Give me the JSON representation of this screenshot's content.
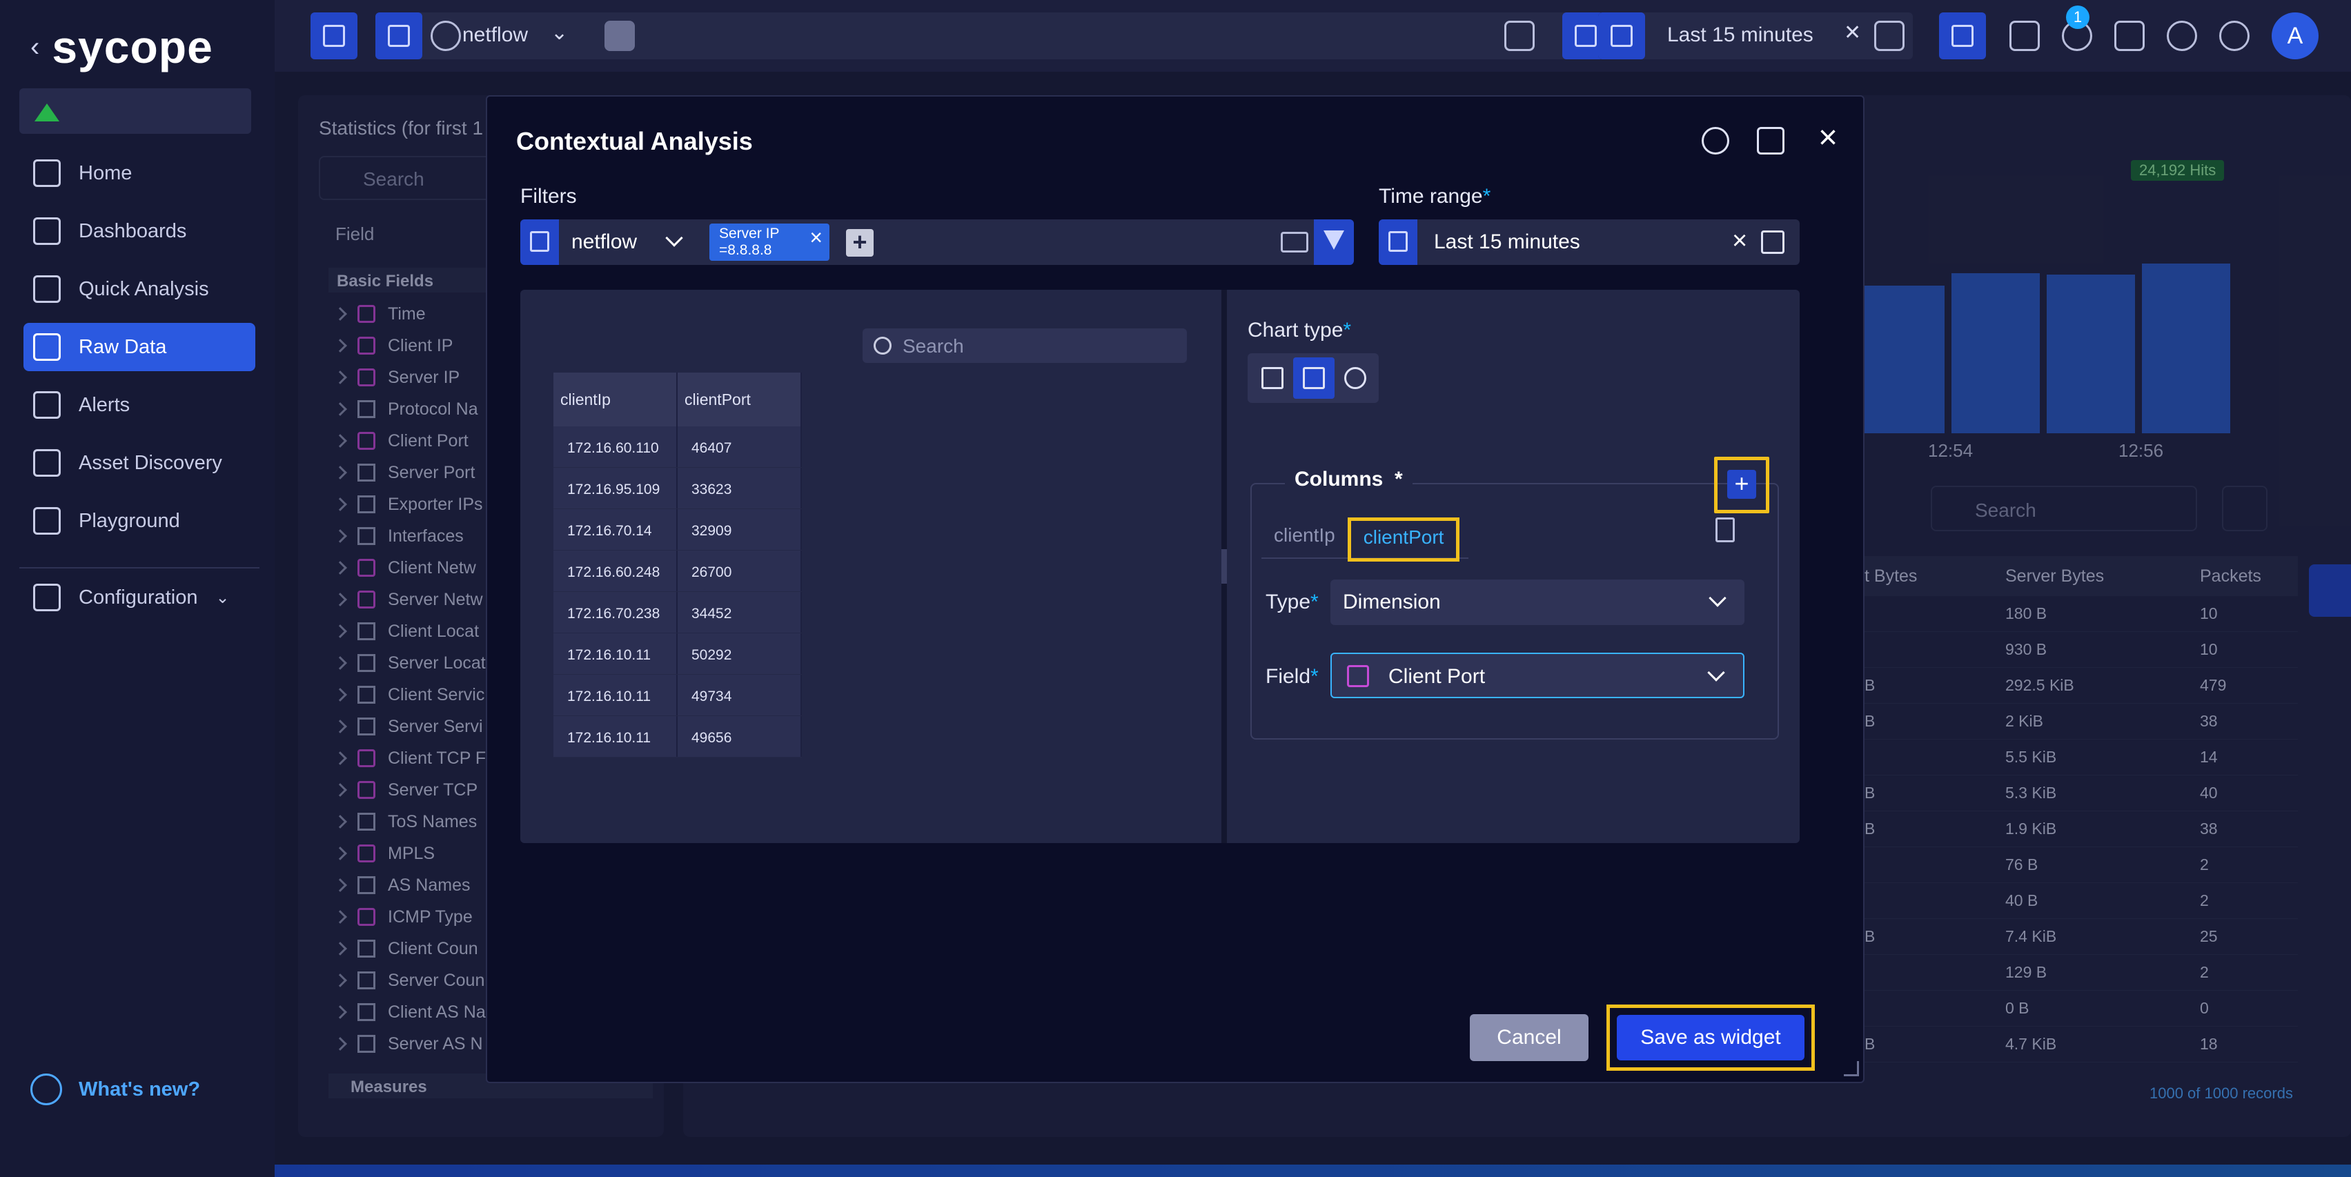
{
  "app": {
    "brand": "sycope"
  },
  "sidebar": {
    "items": [
      {
        "label": "Home",
        "icon": "home-icon"
      },
      {
        "label": "Dashboards",
        "icon": "dashboards-icon"
      },
      {
        "label": "Quick Analysis",
        "icon": "quick-analysis-icon"
      },
      {
        "label": "Raw Data",
        "icon": "raw-data-icon",
        "active": true
      },
      {
        "label": "Alerts",
        "icon": "alerts-icon"
      },
      {
        "label": "Asset Discovery",
        "icon": "asset-discovery-icon"
      },
      {
        "label": "Playground",
        "icon": "playground-icon"
      }
    ],
    "configuration": "Configuration",
    "whats_new": "What's new?"
  },
  "topbar": {
    "datasource": "netflow",
    "time_range": "Last 15 minutes",
    "notifications_count": "1",
    "avatar": "A"
  },
  "background_left": {
    "title": "Statistics (for first 1",
    "search_placeholder": "Search",
    "field_header": "Field",
    "basic_fields": "Basic Fields",
    "fields": [
      "Time",
      "Client IP",
      "Server IP",
      "Protocol Na",
      "Client Port",
      "Server Port",
      "Exporter IPs",
      "Interfaces",
      "Client Netw",
      "Server Netw",
      "Client Locat",
      "Server Locat",
      "Client Servic",
      "Server Servi",
      "Client TCP F",
      "Server TCP",
      "ToS Names",
      "MPLS",
      "AS Names",
      "ICMP Type",
      "Client Coun",
      "Server Coun",
      "Client AS Na",
      "Server AS N"
    ],
    "measures": "Measures"
  },
  "background_right": {
    "hits": "24,192 Hits",
    "axis_labels": [
      "12:54",
      "12:56"
    ],
    "search_placeholder": "Search",
    "table_headers": [
      "t Bytes",
      "Server Bytes",
      "Packets"
    ],
    "table_rows": [
      [
        "",
        "180 B",
        "10"
      ],
      [
        "",
        "930 B",
        "10"
      ],
      [
        "B",
        "292.5 KiB",
        "479"
      ],
      [
        "B",
        "2 KiB",
        "38"
      ],
      [
        "",
        "5.5 KiB",
        "14"
      ],
      [
        "B",
        "5.3 KiB",
        "40"
      ],
      [
        "B",
        "1.9 KiB",
        "38"
      ],
      [
        "",
        "76 B",
        "2"
      ],
      [
        "",
        "40 B",
        "2"
      ],
      [
        "B",
        "7.4 KiB",
        "25"
      ],
      [
        "",
        "129 B",
        "2"
      ],
      [
        "",
        "0 B",
        "0"
      ],
      [
        "B",
        "4.7 KiB",
        "18"
      ]
    ],
    "records": "1000 of 1000 records"
  },
  "modal": {
    "title": "Contextual Analysis",
    "filters_label": "Filters",
    "filter_datasource": "netflow",
    "filter_chip_line1": "Server IP",
    "filter_chip_line2": "=8.8.8.8",
    "time_range_label": "Time range",
    "time_range_value": "Last 15 minutes",
    "preview_search_placeholder": "Search",
    "preview_headers": [
      "clientIp",
      "clientPort"
    ],
    "preview_rows": [
      [
        "172.16.60.110",
        "46407"
      ],
      [
        "172.16.95.109",
        "33623"
      ],
      [
        "172.16.70.14",
        "32909"
      ],
      [
        "172.16.60.248",
        "26700"
      ],
      [
        "172.16.70.238",
        "34452"
      ],
      [
        "172.16.10.11",
        "50292"
      ],
      [
        "172.16.10.11",
        "49734"
      ],
      [
        "172.16.10.11",
        "49656"
      ]
    ],
    "chart_type_label": "Chart type",
    "columns_label": "Columns",
    "columns_required": "*",
    "column_tabs": [
      "clientIp",
      "clientPort"
    ],
    "type_label": "Type",
    "type_value": "Dimension",
    "field_label": "Field",
    "field_value": "Client Port",
    "cancel": "Cancel",
    "save": "Save as widget"
  },
  "colors": {
    "accent": "#2346c8",
    "highlight": "#f2c01d",
    "link": "#39b3ff"
  }
}
